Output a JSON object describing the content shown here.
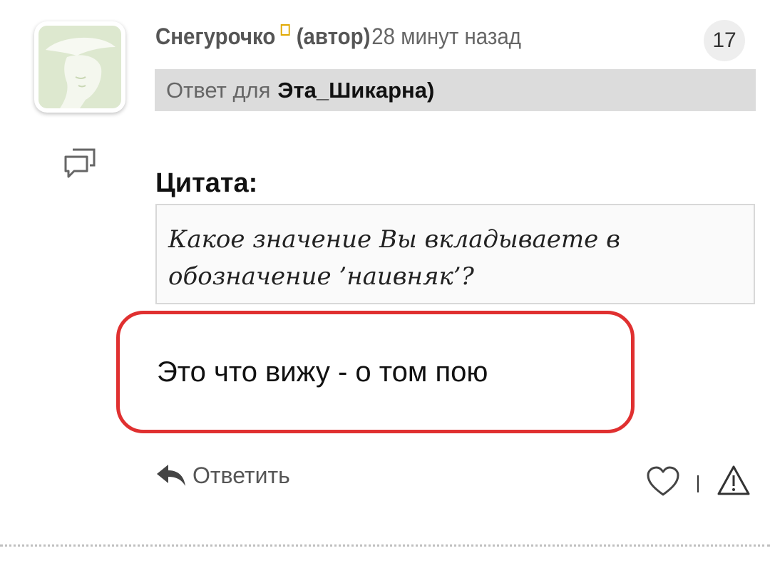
{
  "comment": {
    "author": "Снегурочко",
    "author_role": "(автор)",
    "time_ago": "28 минут назад",
    "count": "17",
    "reply_to_prefix": "Ответ для",
    "reply_to_target": "Эта_Шикарна)",
    "quote_title": "Цитата:",
    "quote_line1": "Какое значение Вы вкладываете в",
    "quote_line2": "обозначение ’наивняк’?",
    "answer": "Это что вижу - о том пою",
    "highlight_color": "#e03030"
  },
  "actions": {
    "reply_label": "Ответить"
  },
  "icons": {
    "avatar": "avatar-woman-hat",
    "thread": "thread-icon",
    "reply": "reply-arrow-icon",
    "like": "heart-icon",
    "report": "warning-icon"
  }
}
